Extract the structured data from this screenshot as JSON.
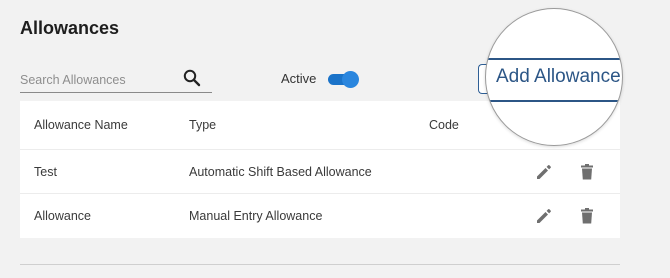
{
  "page": {
    "title": "Allowances"
  },
  "search": {
    "placeholder": "Search Allowances",
    "value": "",
    "icon": "search-icon"
  },
  "filter": {
    "active_label": "Active",
    "active_on": true,
    "accent": "#1a73c9"
  },
  "actions": {
    "add_label": "Add Allowance",
    "color": "#2c5686"
  },
  "table": {
    "columns": [
      "Allowance Name",
      "Type",
      "Code"
    ],
    "rows": [
      {
        "name": "Test",
        "type": "Automatic Shift Based Allowance",
        "code": "",
        "actions": [
          "edit-icon",
          "delete-icon"
        ]
      },
      {
        "name": "Allowance",
        "type": "Manual Entry Allowance",
        "code": "",
        "actions": [
          "edit-icon",
          "delete-icon"
        ]
      }
    ]
  }
}
